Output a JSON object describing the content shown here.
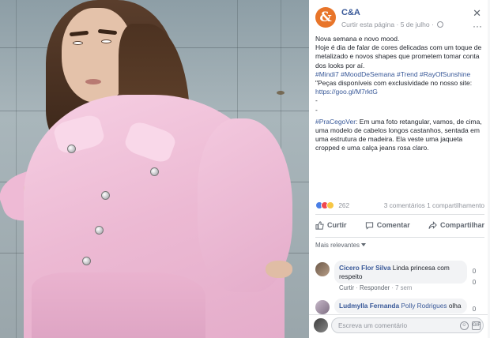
{
  "colors": {
    "link": "#385898",
    "muted": "#90949c",
    "brand": "#e8752a",
    "jacket_pink": "#f6cfe3"
  },
  "photo": {
    "subject": "woman-in-pink-denim-jacket"
  },
  "post": {
    "page_name": "C&A",
    "avatar_glyph": "&",
    "follow_label": "Curtir esta página",
    "dot": "·",
    "date": "5 de julho",
    "more_glyph": "···",
    "close_glyph": "✕",
    "lines": [
      "Nova semana e novo mood.",
      "Hoje é dia de falar de cores delicadas com um toque de metalizado e novos shapes que prometem tomar conta dos looks por aí."
    ],
    "hashtags": "#Mindi7 #MoodDeSemana #Trend #RayOfSunshine",
    "available": "\"Peças disponíveis com exclusividade no nosso site:",
    "link": "https://goo.gl/M7rktG",
    "dot1": "-",
    "dot2": "-",
    "accessibility": "#PraCegoVer: Em uma foto retangular, vamos, de cima, uma modelo de cabelos longos castanhos, sentada em uma estrutura de madeira. Ela veste uma jaqueta cropped e uma calça jeans rosa claro.",
    "reaction_count": "262",
    "comments_shares": "3 comentários  1 compartilhamento"
  },
  "actions": {
    "like": "Curtir",
    "comment": "Comentar",
    "share": "Compartilhar"
  },
  "comments_filter": "Mais relevantes",
  "comments": [
    {
      "author": "Cicero Flor Silva",
      "text": "Linda princesa com respeito",
      "like": "Curtir",
      "reply": "Responder",
      "time": "7 sem",
      "count_a": "0",
      "count_b": "0"
    },
    {
      "author": "Ludmylla Fernanda",
      "mention": "Polly Rodrigues",
      "text": "olha",
      "count_a": "0"
    }
  ],
  "composer": {
    "placeholder": "Escreva um comentário",
    "emoji_label": "☺",
    "gif_label": "GIF"
  }
}
